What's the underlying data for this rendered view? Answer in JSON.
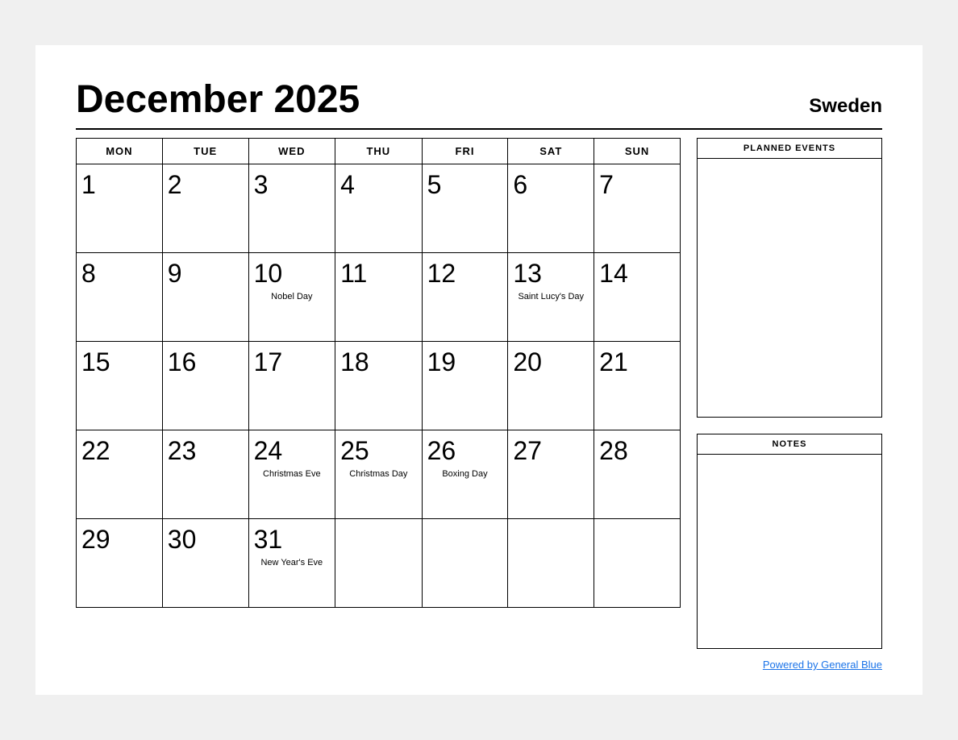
{
  "header": {
    "title": "December 2025",
    "country": "Sweden"
  },
  "days_of_week": [
    "MON",
    "TUE",
    "WED",
    "THU",
    "FRI",
    "SAT",
    "SUN"
  ],
  "weeks": [
    [
      {
        "day": "1",
        "event": ""
      },
      {
        "day": "2",
        "event": ""
      },
      {
        "day": "3",
        "event": ""
      },
      {
        "day": "4",
        "event": ""
      },
      {
        "day": "5",
        "event": ""
      },
      {
        "day": "6",
        "event": ""
      },
      {
        "day": "7",
        "event": ""
      }
    ],
    [
      {
        "day": "8",
        "event": ""
      },
      {
        "day": "9",
        "event": ""
      },
      {
        "day": "10",
        "event": "Nobel Day"
      },
      {
        "day": "11",
        "event": ""
      },
      {
        "day": "12",
        "event": ""
      },
      {
        "day": "13",
        "event": "Saint Lucy's Day"
      },
      {
        "day": "14",
        "event": ""
      }
    ],
    [
      {
        "day": "15",
        "event": ""
      },
      {
        "day": "16",
        "event": ""
      },
      {
        "day": "17",
        "event": ""
      },
      {
        "day": "18",
        "event": ""
      },
      {
        "day": "19",
        "event": ""
      },
      {
        "day": "20",
        "event": ""
      },
      {
        "day": "21",
        "event": ""
      }
    ],
    [
      {
        "day": "22",
        "event": ""
      },
      {
        "day": "23",
        "event": ""
      },
      {
        "day": "24",
        "event": "Christmas Eve"
      },
      {
        "day": "25",
        "event": "Christmas Day"
      },
      {
        "day": "26",
        "event": "Boxing Day"
      },
      {
        "day": "27",
        "event": ""
      },
      {
        "day": "28",
        "event": ""
      }
    ],
    [
      {
        "day": "29",
        "event": ""
      },
      {
        "day": "30",
        "event": ""
      },
      {
        "day": "31",
        "event": "New Year's Eve"
      },
      {
        "day": "",
        "event": ""
      },
      {
        "day": "",
        "event": ""
      },
      {
        "day": "",
        "event": ""
      },
      {
        "day": "",
        "event": ""
      }
    ]
  ],
  "sidebar": {
    "planned_events_label": "PLANNED EVENTS",
    "notes_label": "NOTES"
  },
  "footer": {
    "powered_by_text": "Powered by General Blue",
    "powered_by_url": "#"
  }
}
